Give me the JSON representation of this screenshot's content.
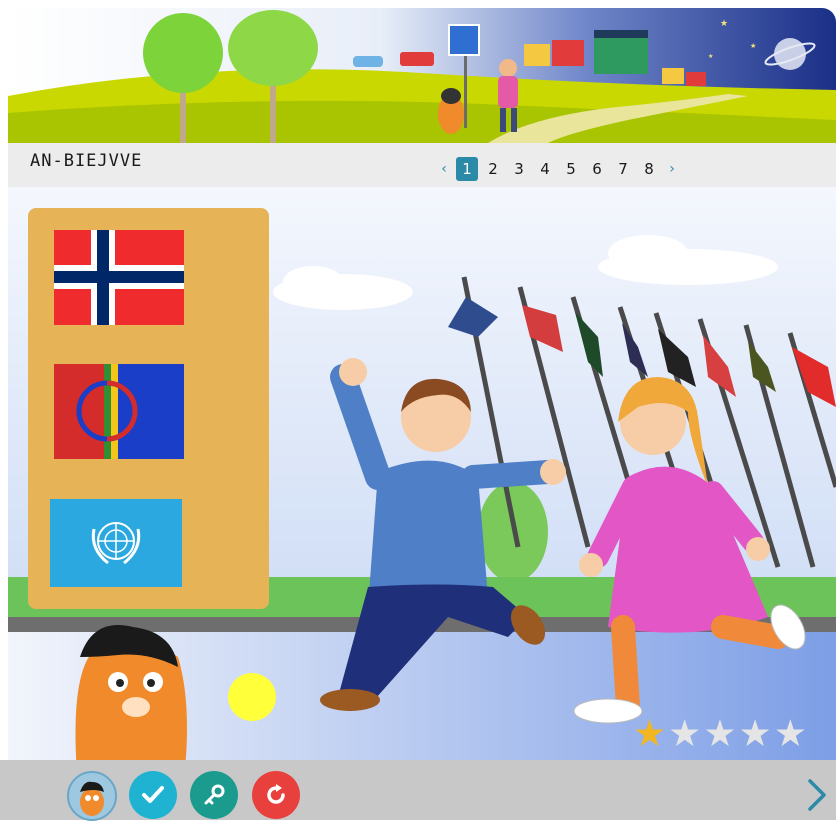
{
  "lesson": {
    "title": "AN-BIEJVVE"
  },
  "pager": {
    "prev_label": "‹",
    "next_label": "›",
    "pages": [
      "1",
      "2",
      "3",
      "4",
      "5",
      "6",
      "7",
      "8"
    ],
    "current_page": 1
  },
  "flags": [
    {
      "name": "Norway",
      "icon": "flag-norway-icon"
    },
    {
      "name": "Sami",
      "icon": "flag-sami-icon"
    },
    {
      "name": "United Nations",
      "icon": "flag-un-icon"
    }
  ],
  "rating": {
    "value": 1,
    "max": 5,
    "filled_star": "★",
    "empty_star": "★"
  },
  "colors": {
    "accent": "#2b8aa8",
    "check_button": "#1fb3d1",
    "key_button": "#1b9a8e",
    "restart_button": "#e8403c",
    "panel": "#e6b457",
    "star_filled": "#f2b623",
    "star_empty": "#e5e5e5"
  },
  "toolbar": {
    "mascot_icon": "mascot-icon",
    "check_icon": "check-icon",
    "key_icon": "key-icon",
    "restart_icon": "restart-icon",
    "next_icon": "chevron-right-icon"
  }
}
